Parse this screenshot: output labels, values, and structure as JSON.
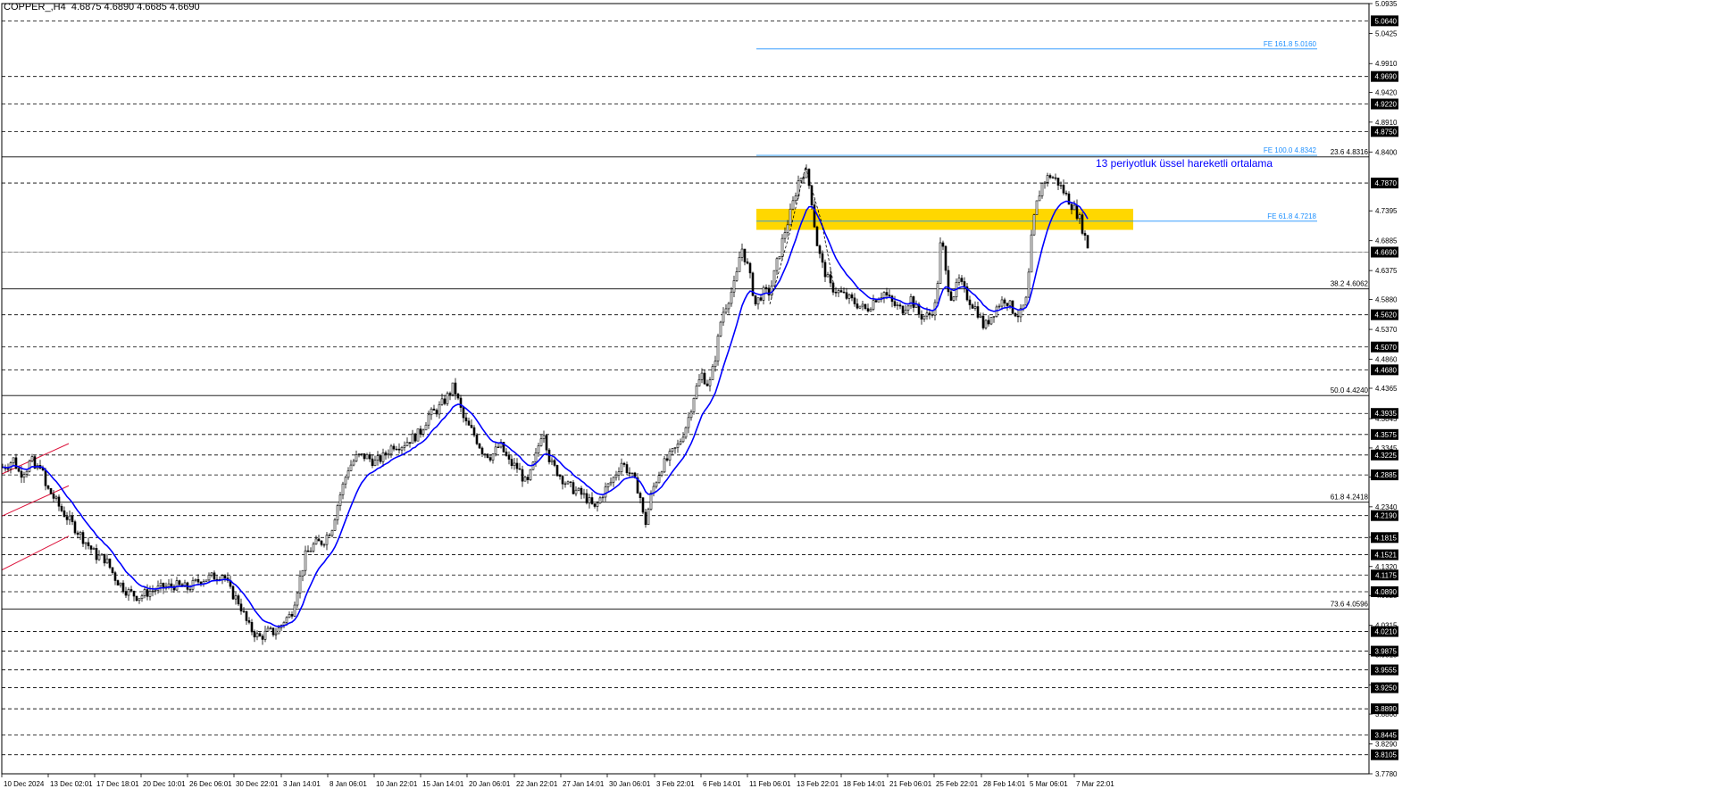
{
  "header": {
    "symbol": "COPPER_,H4",
    "ohlc": "4.6875 4.6890 4.6685 4.6690"
  },
  "annotation": {
    "ema_label": "13 periyotluk üssel hareketli ortalama"
  },
  "colors": {
    "background": "#ffffff",
    "candle": "#000000",
    "ema": "#0000ff",
    "zone": "#ffd700",
    "fib_line": "#000000",
    "fe_line": "#1e90ff",
    "channel": "#dc143c",
    "dashed_level": "#000000",
    "price_box": "#000000"
  },
  "chart_data": {
    "type": "candlestick",
    "symbol": "COPPER_",
    "timeframe": "H4",
    "y_axis_ticks": [
      "5.0935",
      "5.0425",
      "4.9910",
      "4.9420",
      "4.8910",
      "4.8400",
      "4.7395",
      "4.6885",
      "4.6375",
      "4.5880",
      "4.5370",
      "4.4860",
      "4.4365",
      "4.3845",
      "4.3345",
      "4.2850",
      "4.2340",
      "4.1820",
      "4.1320",
      "4.0825",
      "4.0315",
      "3.9815",
      "3.9300",
      "3.8800",
      "3.8290",
      "3.7780"
    ],
    "ylim": [
      3.778,
      5.0935
    ],
    "dashed_levels": [
      "5.0640",
      "4.9690",
      "4.9220",
      "4.8750",
      "4.7870",
      "4.6690",
      "4.5620",
      "4.5070",
      "4.4680",
      "4.3935",
      "4.3575",
      "4.3225",
      "4.2885",
      "4.2190",
      "4.1815",
      "4.1521",
      "4.1175",
      "4.0890",
      "4.0210",
      "3.9875",
      "3.9555",
      "3.9250",
      "3.8890",
      "3.8445",
      "3.8105"
    ],
    "current_price": "4.6690",
    "fib_retracement": [
      {
        "label": "23.6 4.8316",
        "value": 4.8316
      },
      {
        "label": "38.2 4.6062",
        "value": 4.6062
      },
      {
        "label": "50.0 4.4240",
        "value": 4.424
      },
      {
        "label": "61.8 4.2418",
        "value": 4.2418
      },
      {
        "label": "73.6 4.0596",
        "value": 4.0596
      }
    ],
    "fib_expansion": [
      {
        "label": "FE 161.8 5.0160",
        "value": 5.016
      },
      {
        "label": "FE 100.0 4.8342",
        "value": 4.8342
      },
      {
        "label": "FE 61.8 4.7218",
        "value": 4.7218
      }
    ],
    "resistance_zone": [
      4.707,
      4.743
    ],
    "x_labels": [
      "10 Dec 2024",
      "13 Dec 02:01",
      "17 Dec 18:01",
      "20 Dec 10:01",
      "26 Dec 06:01",
      "30 Dec 22:01",
      "3 Jan 14:01",
      "8 Jan 06:01",
      "10 Jan 22:01",
      "15 Jan 14:01",
      "20 Jan 06:01",
      "22 Jan 22:01",
      "27 Jan 14:01",
      "30 Jan 06:01",
      "3 Feb 22:01",
      "6 Feb 14:01",
      "11 Feb 06:01",
      "13 Feb 22:01",
      "18 Feb 14:01",
      "21 Feb 06:01",
      "25 Feb 22:01",
      "28 Feb 14:01",
      "5 Mar 06:01",
      "7 Mar 22:01"
    ],
    "price_path": [
      [
        0,
        4.3
      ],
      [
        8,
        4.305
      ],
      [
        15,
        4.315
      ],
      [
        22,
        4.29
      ],
      [
        30,
        4.3
      ],
      [
        35,
        4.315
      ],
      [
        40,
        4.295
      ],
      [
        46,
        4.31
      ],
      [
        50,
        4.27
      ],
      [
        58,
        4.255
      ],
      [
        68,
        4.23
      ],
      [
        78,
        4.21
      ],
      [
        88,
        4.19
      ],
      [
        98,
        4.17
      ],
      [
        108,
        4.15
      ],
      [
        118,
        4.145
      ],
      [
        130,
        4.11
      ],
      [
        142,
        4.09
      ],
      [
        155,
        4.08
      ],
      [
        168,
        4.09
      ],
      [
        180,
        4.095
      ],
      [
        195,
        4.1
      ],
      [
        210,
        4.095
      ],
      [
        225,
        4.11
      ],
      [
        240,
        4.115
      ],
      [
        250,
        4.12
      ],
      [
        258,
        4.09
      ],
      [
        268,
        4.07
      ],
      [
        278,
        4.03
      ],
      [
        290,
        4.01
      ],
      [
        300,
        4.02
      ],
      [
        310,
        4.02
      ],
      [
        318,
        4.04
      ],
      [
        326,
        4.05
      ],
      [
        334,
        4.1
      ],
      [
        342,
        4.15
      ],
      [
        352,
        4.17
      ],
      [
        362,
        4.175
      ],
      [
        372,
        4.2
      ],
      [
        380,
        4.25
      ],
      [
        390,
        4.3
      ],
      [
        400,
        4.32
      ],
      [
        410,
        4.32
      ],
      [
        420,
        4.31
      ],
      [
        430,
        4.32
      ],
      [
        440,
        4.34
      ],
      [
        450,
        4.34
      ],
      [
        460,
        4.35
      ],
      [
        470,
        4.36
      ],
      [
        480,
        4.39
      ],
      [
        490,
        4.4
      ],
      [
        500,
        4.42
      ],
      [
        508,
        4.44
      ],
      [
        514,
        4.41
      ],
      [
        520,
        4.38
      ],
      [
        530,
        4.36
      ],
      [
        540,
        4.33
      ],
      [
        550,
        4.32
      ],
      [
        560,
        4.34
      ],
      [
        570,
        4.31
      ],
      [
        580,
        4.3
      ],
      [
        590,
        4.27
      ],
      [
        600,
        4.32
      ],
      [
        608,
        4.37
      ],
      [
        616,
        4.31
      ],
      [
        626,
        4.29
      ],
      [
        636,
        4.27
      ],
      [
        646,
        4.26
      ],
      [
        656,
        4.25
      ],
      [
        666,
        4.23
      ],
      [
        676,
        4.26
      ],
      [
        686,
        4.28
      ],
      [
        696,
        4.31
      ],
      [
        706,
        4.29
      ],
      [
        716,
        4.26
      ],
      [
        722,
        4.2
      ],
      [
        730,
        4.26
      ],
      [
        740,
        4.3
      ],
      [
        750,
        4.32
      ],
      [
        760,
        4.34
      ],
      [
        770,
        4.38
      ],
      [
        778,
        4.43
      ],
      [
        786,
        4.46
      ],
      [
        794,
        4.44
      ],
      [
        800,
        4.48
      ],
      [
        808,
        4.56
      ],
      [
        816,
        4.59
      ],
      [
        824,
        4.62
      ],
      [
        830,
        4.68
      ],
      [
        838,
        4.64
      ],
      [
        846,
        4.58
      ],
      [
        854,
        4.6
      ],
      [
        862,
        4.6
      ],
      [
        870,
        4.65
      ],
      [
        878,
        4.7
      ],
      [
        886,
        4.74
      ],
      [
        894,
        4.79
      ],
      [
        902,
        4.81
      ],
      [
        908,
        4.77
      ],
      [
        914,
        4.69
      ],
      [
        920,
        4.65
      ],
      [
        930,
        4.61
      ],
      [
        940,
        4.6
      ],
      [
        950,
        4.59
      ],
      [
        960,
        4.58
      ],
      [
        970,
        4.57
      ],
      [
        980,
        4.59
      ],
      [
        990,
        4.6
      ],
      [
        1000,
        4.58
      ],
      [
        1010,
        4.57
      ],
      [
        1020,
        4.59
      ],
      [
        1030,
        4.56
      ],
      [
        1040,
        4.56
      ],
      [
        1048,
        4.58
      ],
      [
        1054,
        4.7
      ],
      [
        1060,
        4.62
      ],
      [
        1066,
        4.59
      ],
      [
        1074,
        4.62
      ],
      [
        1084,
        4.59
      ],
      [
        1094,
        4.57
      ],
      [
        1102,
        4.54
      ],
      [
        1110,
        4.56
      ],
      [
        1118,
        4.58
      ],
      [
        1126,
        4.59
      ],
      [
        1134,
        4.57
      ],
      [
        1142,
        4.56
      ],
      [
        1150,
        4.59
      ],
      [
        1156,
        4.71
      ],
      [
        1162,
        4.76
      ],
      [
        1168,
        4.79
      ],
      [
        1176,
        4.8
      ],
      [
        1184,
        4.79
      ],
      [
        1192,
        4.77
      ],
      [
        1200,
        4.75
      ],
      [
        1208,
        4.73
      ],
      [
        1214,
        4.7
      ],
      [
        1220,
        4.669
      ]
    ]
  }
}
